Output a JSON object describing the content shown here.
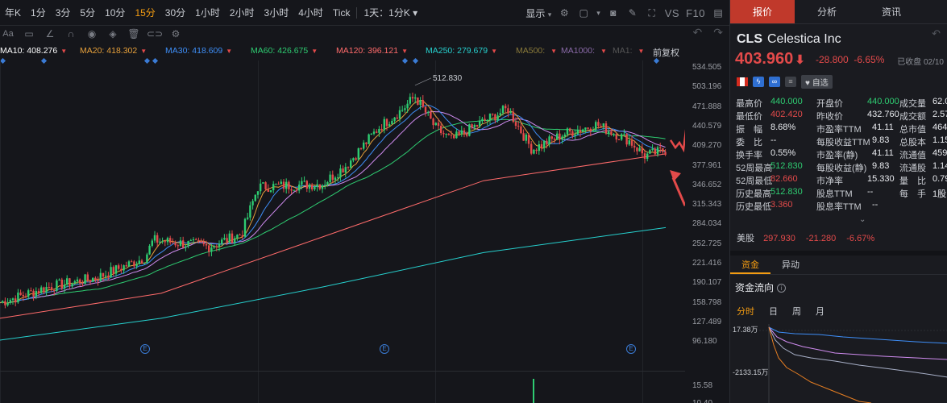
{
  "toolbar": {
    "timeframes": [
      "年K",
      "1分",
      "3分",
      "5分",
      "10分",
      "15分",
      "30分",
      "1小时",
      "2小时",
      "3小时",
      "4小时",
      "Tick"
    ],
    "active_timeframe": "15分",
    "range_select": "1天：1分K",
    "display_label": "显示",
    "vs_label": "VS",
    "f10_label": "F10"
  },
  "ma": [
    {
      "label": "MA10:",
      "value": "408.276",
      "color": "#ffffff"
    },
    {
      "label": "MA20:",
      "value": "418.302",
      "color": "#e6a03b"
    },
    {
      "label": "MA30:",
      "value": "418.609",
      "color": "#3e8ef7"
    },
    {
      "label": "MA60:",
      "value": "426.675",
      "color": "#2ecc71"
    },
    {
      "label": "MA120:",
      "value": "396.121",
      "color": "#ff6b6b"
    },
    {
      "label": "MA250:",
      "value": "279.679",
      "color": "#26d0ce"
    },
    {
      "label": "MA500:",
      "value": "",
      "color": "#8a7a3a"
    },
    {
      "label": "MA1000:",
      "value": "",
      "color": "#8a6aa8"
    },
    {
      "label": "MA1:",
      "value": "",
      "color": "#555"
    }
  ],
  "fq_label": "前复权",
  "price_axis": [
    "534.505",
    "503.196",
    "471.888",
    "440.579",
    "409.270",
    "377.961",
    "346.652",
    "315.343",
    "284.034",
    "252.725",
    "221.416",
    "190.107",
    "158.798",
    "127.489",
    "96.180"
  ],
  "volume_axis": [
    "15.58",
    "10.40"
  ],
  "peak_label": "512.830",
  "e_marks": [
    "E",
    "E",
    "E"
  ],
  "panel": {
    "tabs": [
      "报价",
      "分析",
      "资讯"
    ],
    "symbol": "CLS",
    "name": "Celestica Inc",
    "price": "403.960",
    "arrow": "⬇",
    "change": "-28.800",
    "change_pct": "-6.65%",
    "status": "已收盘 02/10",
    "badges": [
      "ϟ",
      "∞",
      "≡"
    ],
    "watch_label": "自选",
    "stats": [
      [
        [
          "最高价",
          "440.000",
          "green"
        ],
        [
          "开盘价",
          "440.000",
          "green"
        ],
        [
          "成交量",
          "62.0",
          "w"
        ]
      ],
      [
        [
          "最低价",
          "402.420",
          "red"
        ],
        [
          "昨收价",
          "432.760",
          "w"
        ],
        [
          "成交额",
          "2.57",
          "w"
        ]
      ],
      [
        [
          "振　幅",
          "8.68%",
          "w"
        ],
        [
          "市盈率TTM",
          "41.11",
          "w"
        ],
        [
          "总市值",
          "464",
          "w"
        ]
      ],
      [
        [
          "委　比",
          "--",
          "w"
        ],
        [
          "每股收益TTM",
          "9.83",
          "w"
        ],
        [
          "总股本",
          "1.15",
          "w"
        ]
      ],
      [
        [
          "换手率",
          "0.55%",
          "w"
        ],
        [
          "市盈率(静)",
          "41.11",
          "w"
        ],
        [
          "流通值",
          "459",
          "w"
        ]
      ],
      [
        [
          "52周最高",
          "512.830",
          "green"
        ],
        [
          "每股收益(静)",
          "9.83",
          "w"
        ],
        [
          "流通股",
          "1.14",
          "w"
        ]
      ],
      [
        [
          "52周最低",
          "82.660",
          "red"
        ],
        [
          "市净率",
          "15.330",
          "w"
        ],
        [
          "量　比",
          "0.79",
          "w"
        ]
      ],
      [
        [
          "历史最高",
          "512.830",
          "green"
        ],
        [
          "股息TTM",
          "--",
          "w"
        ],
        [
          "每　手",
          "1股",
          "w"
        ]
      ],
      [
        [
          "历史最低",
          "3.360",
          "red"
        ],
        [
          "股息率TTM",
          "--",
          "w"
        ],
        [
          "",
          "",
          "w"
        ]
      ]
    ],
    "us": {
      "label": "美股",
      "price": "297.930",
      "change": "-21.280",
      "pct": "-6.67%"
    },
    "tabs2": [
      "资金",
      "异动"
    ],
    "flow_title": "资金流向",
    "periods": [
      "分时",
      "日",
      "周",
      "月"
    ],
    "flow_labels": [
      "17.38万",
      "-2133.15万"
    ]
  },
  "colors": {
    "up": "#e34a4a",
    "down": "#2ecc71",
    "accent": "#f39c12",
    "tab_active": "#c0392b"
  }
}
